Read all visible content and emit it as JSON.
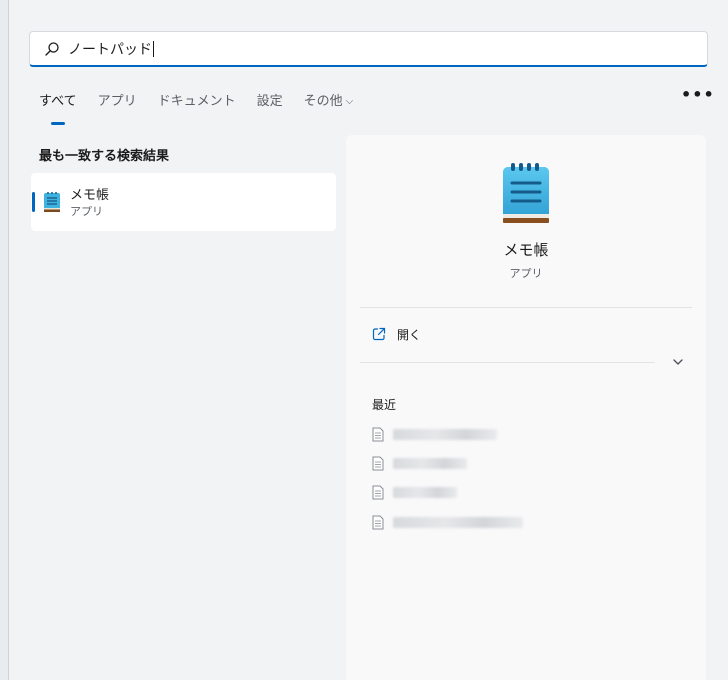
{
  "search": {
    "query": "ノートパッド",
    "icon": "search-icon"
  },
  "tabs": [
    {
      "label": "すべて",
      "active": true
    },
    {
      "label": "アプリ",
      "active": false
    },
    {
      "label": "ドキュメント",
      "active": false
    },
    {
      "label": "設定",
      "active": false
    },
    {
      "label": "その他",
      "active": false,
      "dropdown": true
    }
  ],
  "more_label": "•••",
  "best_match": {
    "section_title": "最も一致する検索結果",
    "name": "メモ帳",
    "kind": "アプリ",
    "icon": "notepad-icon"
  },
  "details": {
    "app_name": "メモ帳",
    "app_kind": "アプリ",
    "icon": "notepad-icon",
    "actions": [
      {
        "label": "開く",
        "icon": "open-external-icon"
      }
    ],
    "recent_title": "最近",
    "recent_items": [
      {
        "name": "",
        "icon": "document-icon"
      },
      {
        "name": "",
        "icon": "document-icon"
      },
      {
        "name": "",
        "icon": "document-icon"
      },
      {
        "name": "",
        "icon": "document-icon"
      }
    ]
  },
  "colors": {
    "accent": "#0067c0",
    "panel_bg": "#f2f3f5",
    "card_bg": "#ffffff"
  }
}
